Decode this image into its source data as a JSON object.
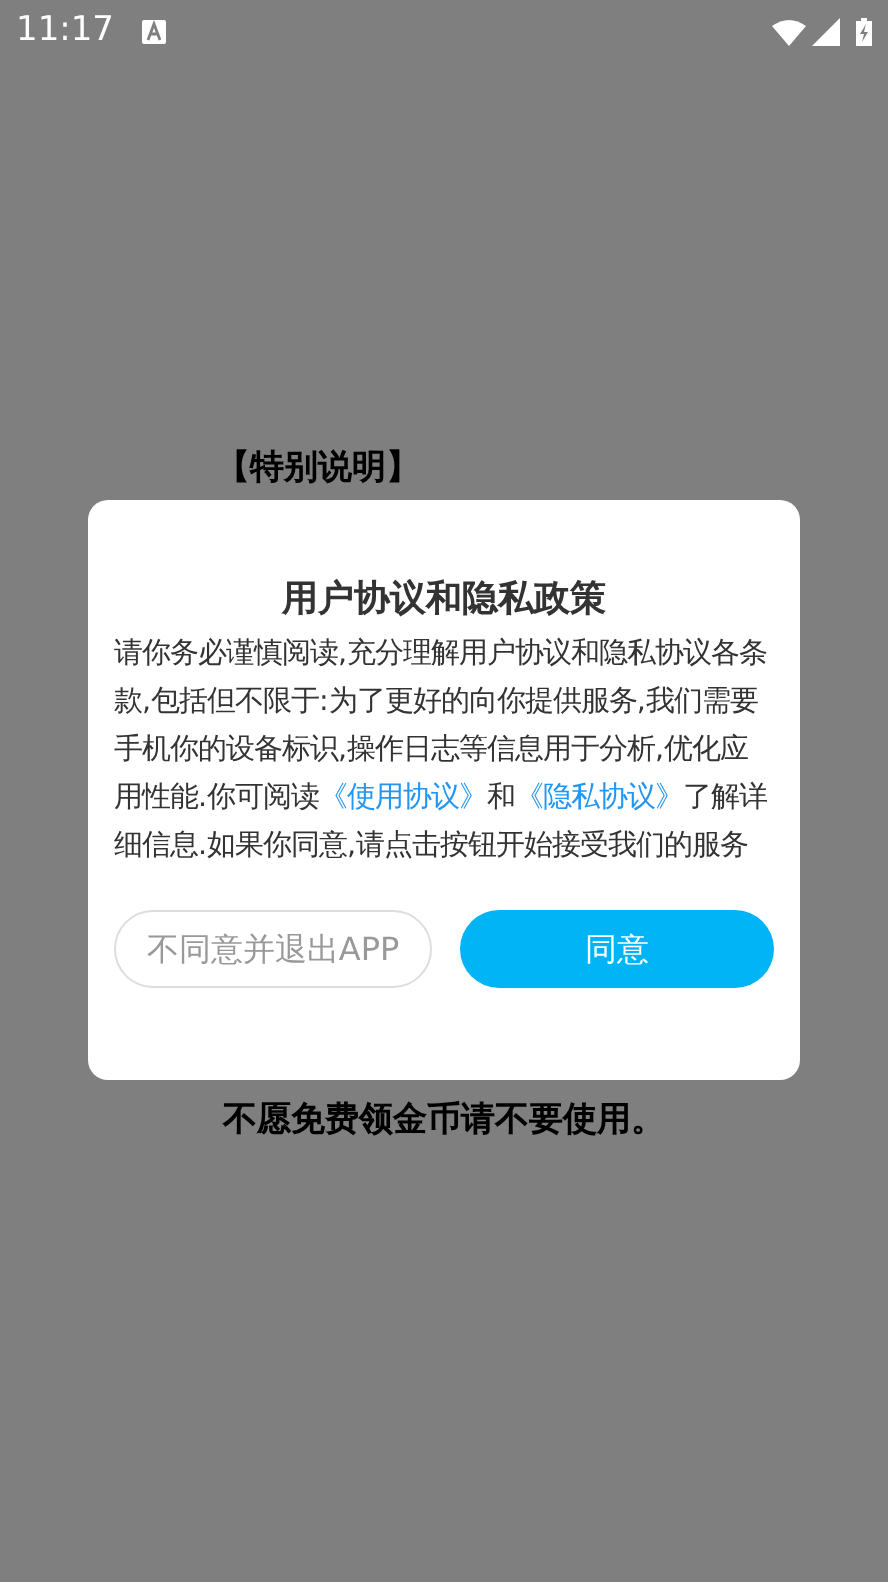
{
  "status_bar": {
    "time": "11:17"
  },
  "background": {
    "heading": "【特别说明】",
    "footer": "不愿免费领金币请不要使用。"
  },
  "dialog": {
    "title": "用户协议和隐私政策",
    "body": [
      {
        "kind": "text",
        "text": "请你务必谨慎阅读,充分理解用户协议和隐私协议各条款,包括但不限于:为了更好的向你提供服务,我们需要手机你的设备标识,操作日志等信息用于分析,优化应用性能.你可阅读"
      },
      {
        "kind": "link",
        "text": "《使用协议》"
      },
      {
        "kind": "text",
        "text": "和"
      },
      {
        "kind": "link",
        "text": "《隐私协议》"
      },
      {
        "kind": "text",
        "text": "了解详细信息.如果你同意,请点击按钮开始接受我们的服务"
      }
    ],
    "buttons": [
      {
        "label": "不同意并退出APP",
        "kind": "secondary"
      },
      {
        "label": "同意",
        "kind": "primary"
      }
    ]
  }
}
